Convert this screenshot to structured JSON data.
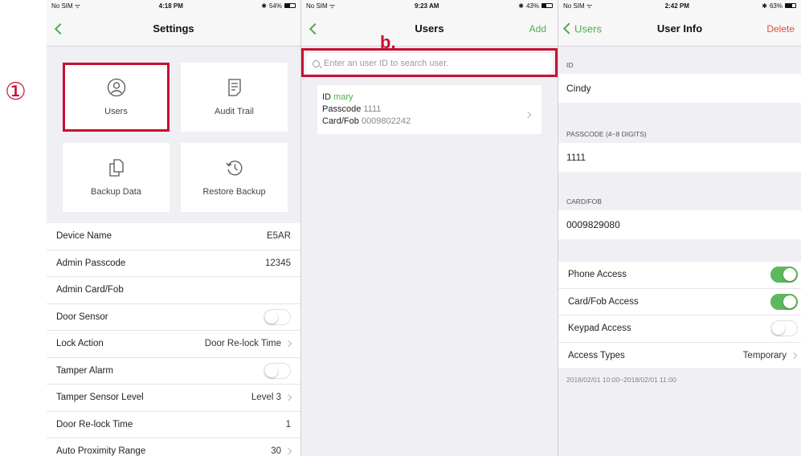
{
  "step_marker": "①",
  "settings": {
    "status": {
      "carrier": "No SIM",
      "time": "4:18 PM",
      "battery": "54%",
      "battery_level": 0.54
    },
    "title": "Settings",
    "tiles": [
      {
        "label": "Users",
        "icon": "user-icon"
      },
      {
        "label": "Audit Trail",
        "icon": "document-icon"
      },
      {
        "label": "Backup Data",
        "icon": "copy-icon"
      },
      {
        "label": "Restore Backup",
        "icon": "history-icon"
      }
    ],
    "rows": [
      {
        "label": "Device Name",
        "value": "E5AR"
      },
      {
        "label": "Admin Passcode",
        "value": "12345"
      },
      {
        "label": "Admin Card/Fob",
        "value": ""
      },
      {
        "label": "Door Sensor",
        "toggle": false
      },
      {
        "label": "Lock Action",
        "value": "Door Re-lock Time",
        "chevron": true
      },
      {
        "label": "Tamper Alarm",
        "toggle": false
      },
      {
        "label": "Tamper Sensor Level",
        "value": "Level 3",
        "chevron": true
      },
      {
        "label": "Door Re-lock Time",
        "value": "1"
      },
      {
        "label": "Auto Proximity Range",
        "value": "30",
        "chevron": true
      }
    ]
  },
  "users": {
    "status": {
      "carrier": "No SIM",
      "time": "9:23 AM",
      "battery": "43%",
      "battery_level": 0.43
    },
    "step_label": "b.",
    "title": "Users",
    "add_label": "Add",
    "search_placeholder": "Enter an user ID to search user.",
    "card": {
      "id_label": "ID",
      "id_value": "mary",
      "passcode_label": "Passcode",
      "passcode_value": "1111",
      "card_label": "Card/Fob",
      "card_value": "0009802242"
    }
  },
  "user_info": {
    "status": {
      "carrier": "No SIM",
      "time": "2:42 PM",
      "battery": "63%",
      "battery_level": 0.63
    },
    "back_label": "Users",
    "title": "User Info",
    "delete_label": "Delete",
    "id_header": "ID",
    "id_value": "Cindy",
    "passcode_header": "PASSCODE (4~8 DIGITS)",
    "passcode_value": "1111",
    "card_header": "CARD/FOB",
    "card_value": "0009829080",
    "access_rows": [
      {
        "label": "Phone Access",
        "toggle": true
      },
      {
        "label": "Card/Fob Access",
        "toggle": true
      },
      {
        "label": "Keypad Access",
        "toggle": false
      },
      {
        "label": "Access Types",
        "value": "Temporary",
        "chevron": true
      }
    ],
    "date_range": "2018/02/01 10:00~2018/02/01 11:00"
  },
  "colors": {
    "accent_green": "#4cae4c",
    "toggle_on": "#5cb85c",
    "highlight_red": "#c8102e",
    "delete_red": "#e74c3c"
  }
}
